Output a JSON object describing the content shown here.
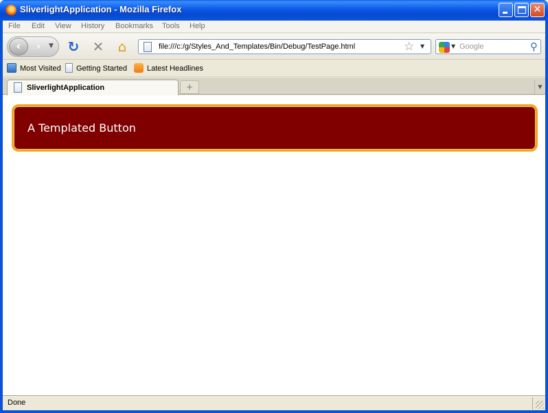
{
  "window": {
    "title": "SliverlightApplication - Mozilla Firefox"
  },
  "menu": {
    "items": [
      "File",
      "Edit",
      "View",
      "History",
      "Bookmarks",
      "Tools",
      "Help"
    ]
  },
  "navigation": {
    "url": "file:///c:/g/Styles_And_Templates/Bin/Debug/TestPage.html",
    "search_placeholder": "Google",
    "icons": [
      "back-icon",
      "forward-icon",
      "reload-icon",
      "stop-icon",
      "home-icon",
      "bookmark-star-icon",
      "search-magnifier-icon"
    ]
  },
  "bookmarks": {
    "items": [
      "Most Visited",
      "Getting Started",
      "Latest Headlines"
    ]
  },
  "tabs": {
    "active_label": "SliverlightApplication"
  },
  "content": {
    "button_label": "A Templated Button",
    "button_bg": "#800000",
    "button_border": "#f3a51d"
  },
  "status": {
    "text": "Done"
  }
}
